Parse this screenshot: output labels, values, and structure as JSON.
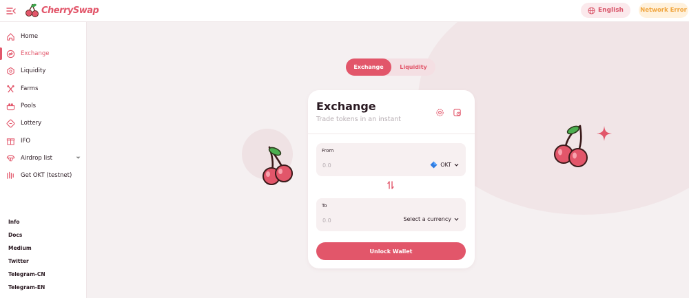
{
  "app": {
    "name": "CherrySwap"
  },
  "header": {
    "language_label": "English",
    "network_label": "Network Error"
  },
  "sidebar": {
    "items": [
      {
        "label": "Home",
        "icon": "home-icon"
      },
      {
        "label": "Exchange",
        "icon": "exchange-icon",
        "active": true
      },
      {
        "label": "Liquidity",
        "icon": "liquidity-icon"
      },
      {
        "label": "Farms",
        "icon": "farms-icon"
      },
      {
        "label": "Pools",
        "icon": "pools-icon"
      },
      {
        "label": "Lottery",
        "icon": "lottery-icon"
      },
      {
        "label": "IFO",
        "icon": "ifo-icon"
      },
      {
        "label": "Airdrop list",
        "icon": "airdrop-icon",
        "expandable": true
      },
      {
        "label": "Get OKT (testnet)",
        "icon": "faucet-icon"
      }
    ],
    "footer_links": [
      "Info",
      "Docs",
      "Medium",
      "Twitter",
      "Telegram-CN",
      "Telegram-EN"
    ]
  },
  "tabs": {
    "exchange": "Exchange",
    "liquidity": "Liquidity"
  },
  "card": {
    "title": "Exchange",
    "subtitle": "Trade tokens in an instant",
    "from": {
      "label": "From",
      "value": "0.0",
      "token": "OKT"
    },
    "to": {
      "label": "To",
      "value": "0.0",
      "token": "Select a currency"
    },
    "button": "Unlock Wallet"
  },
  "colors": {
    "accent": "#e2566a",
    "warning": "#f0a640",
    "background": "#f5f0f1"
  }
}
